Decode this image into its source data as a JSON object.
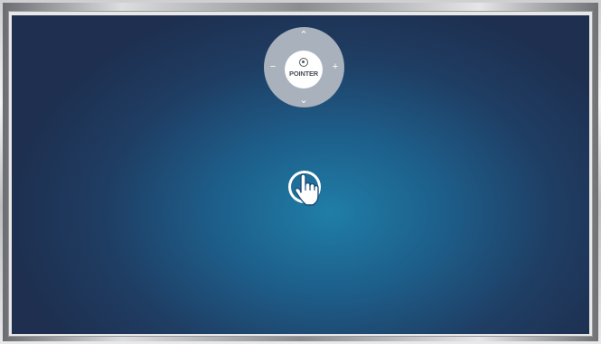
{
  "remote_control": {
    "up_glyph": "⌃",
    "down_glyph": "⌄",
    "left_glyph": "−",
    "right_glyph": "+",
    "center_label": "POINTER",
    "center_icon": "target-icon"
  },
  "cursor": {
    "icon": "hand-pointer-icon"
  },
  "colors": {
    "screen_center": "#1f7ea7",
    "screen_edge": "#1e2f4f",
    "dpad": "#a9b2bc",
    "center_button": "#ffffff"
  }
}
